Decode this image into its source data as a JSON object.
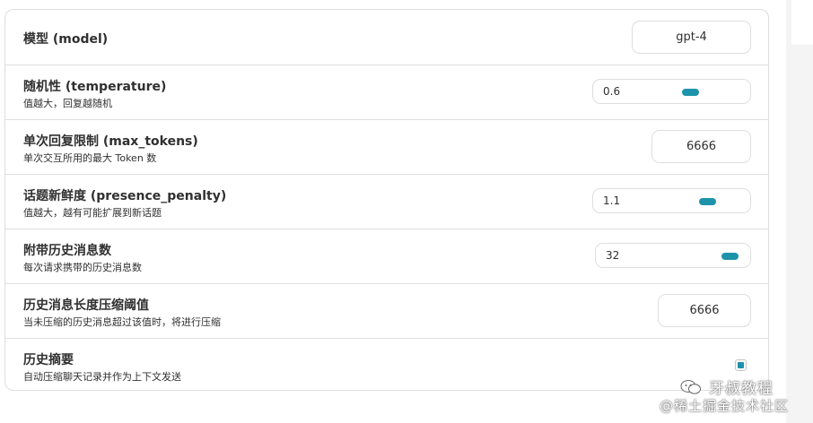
{
  "settings": {
    "model": {
      "title": "模型 (model)",
      "value": "gpt-4"
    },
    "temperature": {
      "title": "随机性 (temperature)",
      "subtitle": "值越大，回复越随机",
      "value": "0.6",
      "fraction": 0.6
    },
    "max_tokens": {
      "title": "单次回复限制 (max_tokens)",
      "subtitle": "单次交互所用的最大 Token 数",
      "value": "6666"
    },
    "presence_penalty": {
      "title": "话题新鲜度 (presence_penalty)",
      "subtitle": "值越大，越有可能扩展到新话题",
      "value": "1.1",
      "fraction": 0.78
    },
    "history_count": {
      "title": "附带历史消息数",
      "subtitle": "每次请求携带的历史消息数",
      "value": "32",
      "fraction": 1.0
    },
    "compress_threshold": {
      "title": "历史消息长度压缩阈值",
      "subtitle": "当未压缩的历史消息超过该值时，将进行压缩",
      "value": "6666"
    },
    "history_summary": {
      "title": "历史摘要",
      "subtitle": "自动压缩聊天记录并作为上下文发送",
      "checked": true
    }
  },
  "watermark": {
    "line1": "牙叔教程",
    "line2": "@稀土掘金技术社区"
  },
  "colors": {
    "accent": "#1d93ab",
    "border": "#dedede"
  }
}
